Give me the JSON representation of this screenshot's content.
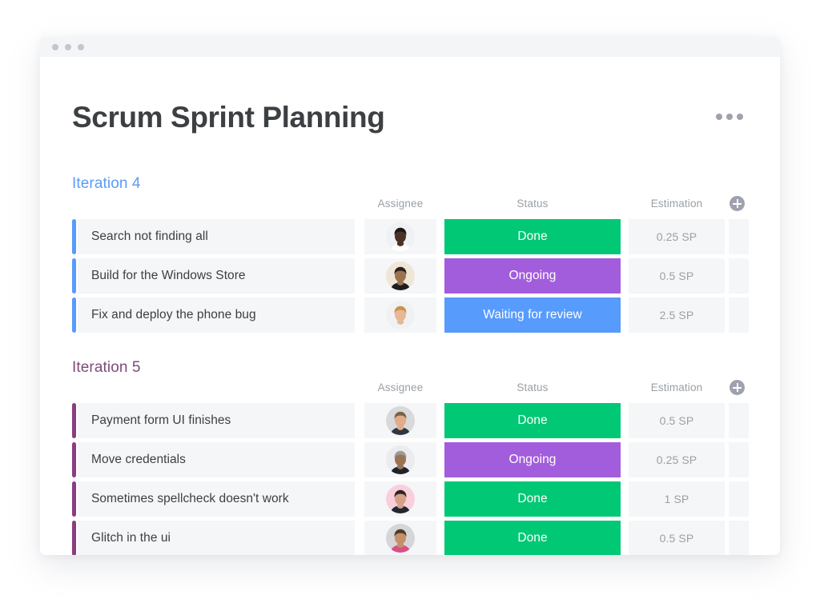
{
  "window": {
    "dots": [
      "window-dot-1",
      "window-dot-2",
      "window-dot-3"
    ]
  },
  "header": {
    "title": "Scrum Sprint Planning",
    "overflow_icon": "ellipsis-horizontal-icon"
  },
  "columns": {
    "assignee": "Assignee",
    "status": "Status",
    "estimation": "Estimation",
    "add_icon": "plus-circle-icon"
  },
  "colors": {
    "done": "#00c875",
    "ongoing": "#a25ddc",
    "waiting": "#579bfc",
    "iteration4_accent": "#5b9bf8",
    "iteration5_accent": "#7e4b78",
    "row_bg": "#f5f6f8",
    "title_text": "#3c4043",
    "muted_text": "#9aa0a6"
  },
  "groups": [
    {
      "title": "Iteration 4",
      "title_color": "#5b9bf8",
      "bar_color": "#579bfc",
      "rows": [
        {
          "task": "Search not finding all",
          "assignee_avatar": "avatar-woman-glasses",
          "status": "Done",
          "status_color": "#00c875",
          "estimation": "0.25 SP"
        },
        {
          "task": "Build for the Windows Store",
          "assignee_avatar": "avatar-man-beard-black-shirt",
          "status": "Ongoing",
          "status_color": "#a25ddc",
          "estimation": "0.5 SP"
        },
        {
          "task": "Fix and deploy the phone bug",
          "assignee_avatar": "avatar-woman-blonde",
          "status": "Waiting for review",
          "status_color": "#579bfc",
          "estimation": "2.5 SP"
        }
      ]
    },
    {
      "title": "Iteration 5",
      "title_color": "#7e4b78",
      "bar_color": "#8b3d82",
      "rows": [
        {
          "task": "Payment form UI finishes",
          "assignee_avatar": "avatar-man-short-hair",
          "status": "Done",
          "status_color": "#00c875",
          "estimation": "0.5 SP"
        },
        {
          "task": "Move credentials",
          "assignee_avatar": "avatar-man-grey-hair",
          "status": "Ongoing",
          "status_color": "#a25ddc",
          "estimation": "0.25 SP"
        },
        {
          "task": "Sometimes spellcheck doesn't work",
          "assignee_avatar": "avatar-woman-pink-bg",
          "status": "Done",
          "status_color": "#00c875",
          "estimation": "1 SP"
        },
        {
          "task": "Glitch in the ui",
          "assignee_avatar": "avatar-man-beard-smiling",
          "status": "Done",
          "status_color": "#00c875",
          "estimation": "0.5 SP"
        }
      ]
    }
  ],
  "avatar_art": {
    "avatar-woman-glasses": {
      "bg": "#f0f1f4",
      "skin": "#4a3229",
      "hair": "#1d1713",
      "cloth": "#ffffff"
    },
    "avatar-man-beard-black-shirt": {
      "bg": "#efe6d8",
      "skin": "#9c7351",
      "hair": "#2b2119",
      "cloth": "#1d1d22"
    },
    "avatar-woman-blonde": {
      "bg": "#f1f1f3",
      "skin": "#e6b894",
      "hair": "#c9914f",
      "cloth": "#f2f2f2"
    },
    "avatar-man-short-hair": {
      "bg": "#d9d9dc",
      "skin": "#e3ab88",
      "hair": "#7a6248",
      "cloth": "#2e3640"
    },
    "avatar-man-grey-hair": {
      "bg": "#ececef",
      "skin": "#9b7353",
      "hair": "#9e9b96",
      "cloth": "#20222b"
    },
    "avatar-woman-pink-bg": {
      "bg": "#f9cfdd",
      "skin": "#d79f86",
      "hair": "#2d2320",
      "cloth": "#232830"
    },
    "avatar-man-beard-smiling": {
      "bg": "#d6d6d9",
      "skin": "#c59068",
      "hair": "#4c3a2c",
      "cloth": "#d94f86"
    }
  }
}
